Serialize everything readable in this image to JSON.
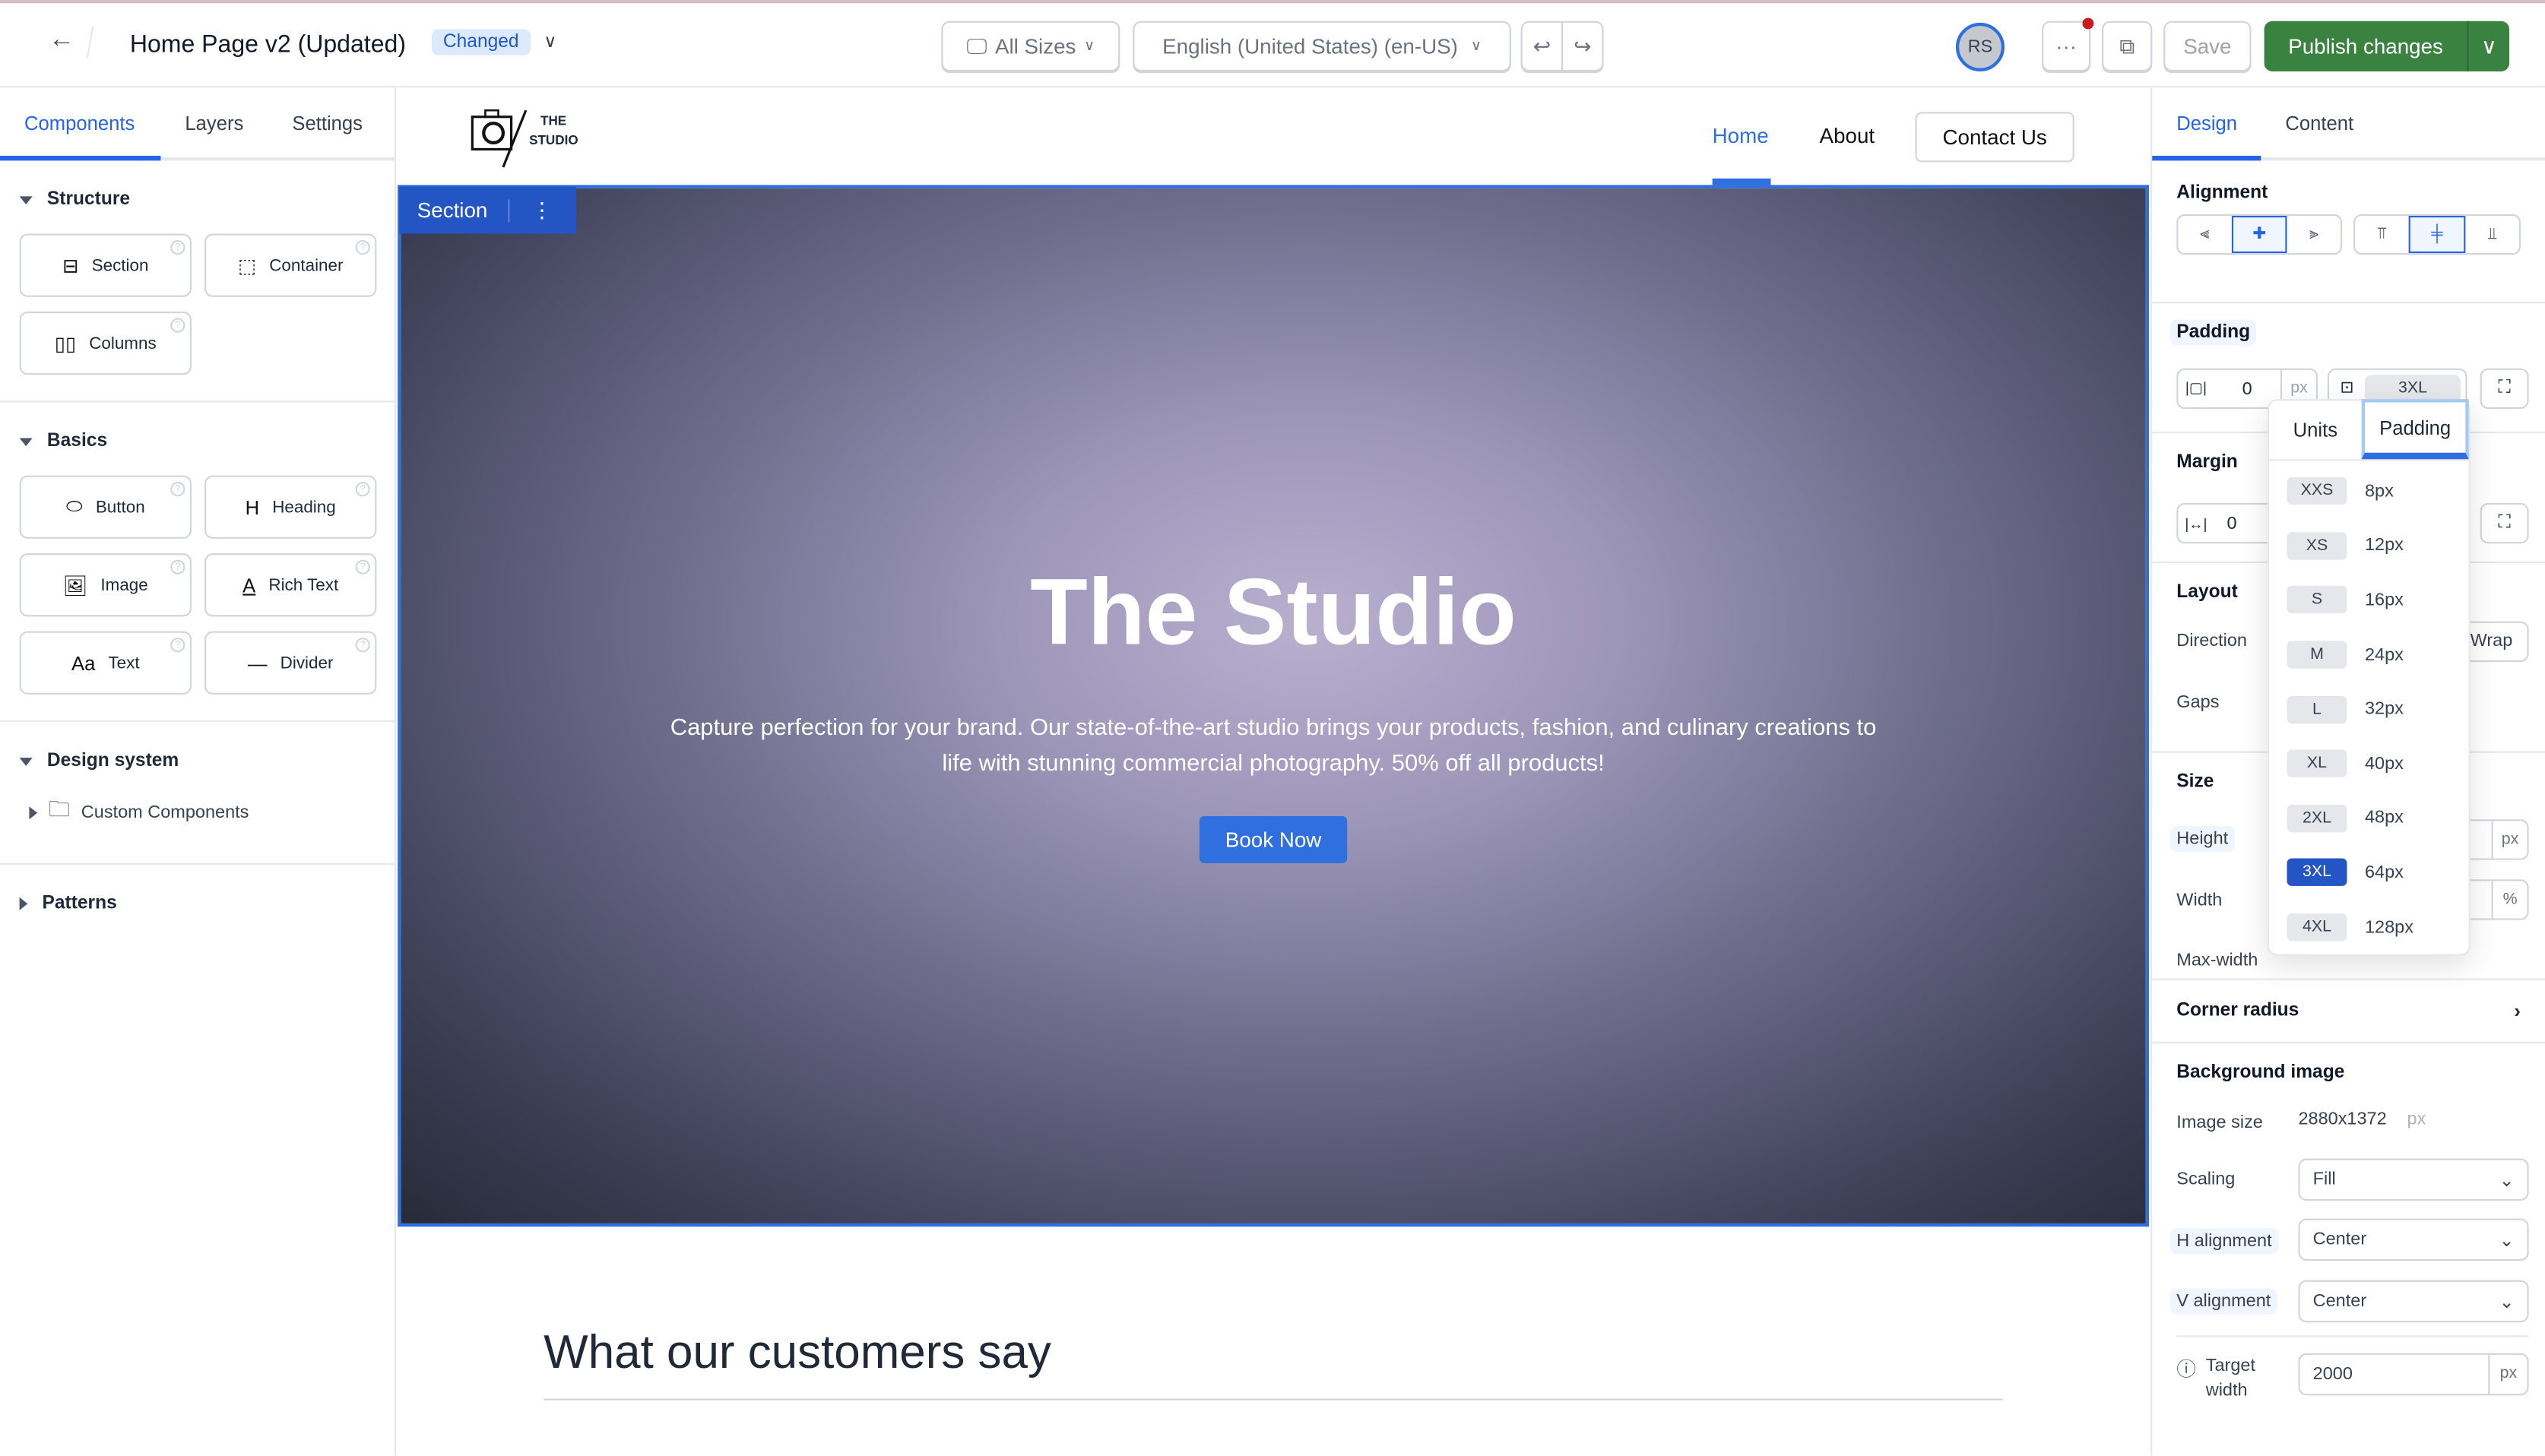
{
  "header": {
    "title": "Home Page v2 (Updated)",
    "status_badge": "Changed",
    "sizes": "All Sizes",
    "locale": "English (United States) (en-US)",
    "avatar": "RS",
    "more": "···",
    "save": "Save",
    "publish": "Publish changes"
  },
  "left": {
    "tabs": [
      "Components",
      "Layers",
      "Settings"
    ],
    "groups": [
      {
        "title": "Structure",
        "items": [
          "Section",
          "Container",
          "Columns"
        ]
      },
      {
        "title": "Basics",
        "items": [
          "Button",
          "Heading",
          "Image",
          "Rich Text",
          "Text",
          "Divider"
        ]
      },
      {
        "title": "Design system",
        "items": [
          "Custom Components"
        ]
      },
      {
        "title": "Patterns",
        "items": []
      }
    ]
  },
  "site": {
    "logo": [
      "THE",
      "STUDIO"
    ],
    "nav": [
      "Home",
      "About",
      "Contact Us"
    ],
    "section_tag": "Section",
    "hero_title": "The Studio",
    "hero_text": "Capture perfection for your brand. Our state-of-the-art studio brings your products, fashion, and culinary creations to life with stunning commercial photography. 50% off all products!",
    "cta": "Book Now",
    "testimonials_title": "What our customers say"
  },
  "right": {
    "tabs": [
      "Design",
      "Content"
    ],
    "alignment": "Alignment",
    "padding": {
      "label": "Padding",
      "value": "0",
      "unit": "px",
      "preset": "3XL"
    },
    "margin": {
      "label": "Margin",
      "value": "0"
    },
    "layout": {
      "label": "Layout",
      "direction": "Direction",
      "wrap": "Wrap",
      "gaps": "Gaps"
    },
    "size": {
      "label": "Size",
      "height": "Height",
      "height_unit": "px",
      "width": "Width",
      "width_unit": "%",
      "max_width": "Max-width"
    },
    "corner_radius": "Corner radius",
    "bg": {
      "label": "Background image",
      "image_size_label": "Image size",
      "image_size": "2880x1372",
      "image_size_unit": "px",
      "scaling_label": "Scaling",
      "scaling": "Fill",
      "h_label": "H alignment",
      "h": "Center",
      "v_label": "V alignment",
      "v": "Center",
      "target_label": "Target width",
      "target": "2000",
      "target_unit": "px"
    }
  },
  "dropdown": {
    "tabs": [
      "Units",
      "Padding"
    ],
    "active_tab": "Padding",
    "selected": "3XL",
    "options": [
      {
        "k": "XXS",
        "v": "8px"
      },
      {
        "k": "XS",
        "v": "12px"
      },
      {
        "k": "S",
        "v": "16px"
      },
      {
        "k": "M",
        "v": "24px"
      },
      {
        "k": "L",
        "v": "32px"
      },
      {
        "k": "XL",
        "v": "40px"
      },
      {
        "k": "2XL",
        "v": "48px"
      },
      {
        "k": "3XL",
        "v": "64px"
      },
      {
        "k": "4XL",
        "v": "128px"
      }
    ]
  },
  "colors": {
    "accent": "#2563eb",
    "publish": "#3a8240",
    "badge_bg": "#dbeafe",
    "section_tag": "#2356c4"
  }
}
